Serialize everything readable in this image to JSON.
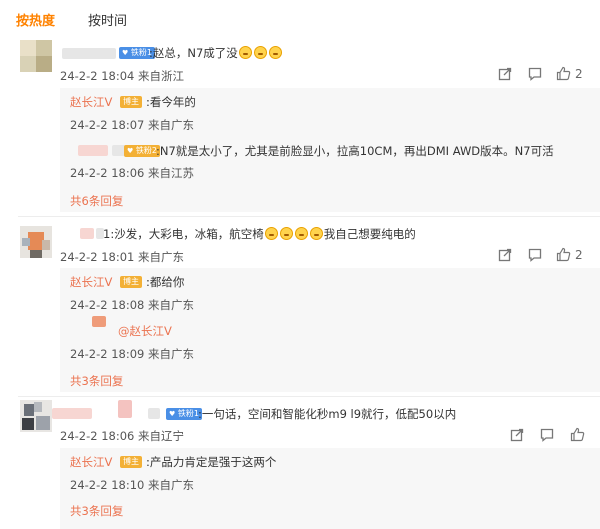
{
  "tabs": {
    "hot": "按热度",
    "time": "按时间"
  },
  "badges": {
    "fan_l1": "铁粉1",
    "fan_l2": "铁粉2",
    "blogger": "博主"
  },
  "comments": [
    {
      "text": ":赵总，N7成了没",
      "meta": "24-2-2 18:04 来自浙江",
      "likes": "2",
      "replies": [
        {
          "author": "赵长江V",
          "text": ":看今年的",
          "meta": "24-2-2 18:07 来自广东"
        },
        {
          "text": ":N7就是太小了，尤其是前脸显小，拉高10CM，再出DMI AWD版本。N7可活",
          "meta": "24-2-2 18:06 来自江苏"
        }
      ],
      "more": "共6条回复"
    },
    {
      "text_prefix": "1:沙发，大彩电，冰箱，航空椅",
      "text_suffix": "我自己想要纯电的",
      "meta": "24-2-2 18:01 来自广东",
      "likes": "2",
      "replies": [
        {
          "author": "赵长江V",
          "text": ":都给你",
          "meta": "24-2-2 18:08 来自广东"
        },
        {
          "text": "@赵长江V",
          "meta": "24-2-2 18:09 来自广东"
        }
      ],
      "more": "共3条回复"
    },
    {
      "text": ":一句话，空间和智能化秒m9 l9就行，低配50以内",
      "meta": "24-2-2 18:06 来自辽宁",
      "replies": [
        {
          "author": "赵长江V",
          "text": ":产品力肯定是强于这两个",
          "meta": "24-2-2 18:10 来自广东"
        }
      ],
      "more": "共3条回复"
    }
  ],
  "colors": {
    "accent": "#ff8200",
    "link": "#eb7350",
    "fan_badge": "#4a8fe6",
    "blogger_badge": "#f3b035",
    "reply_bg": "#f7f7f7"
  },
  "icons": [
    "share-icon",
    "comment-icon",
    "like-icon"
  ]
}
